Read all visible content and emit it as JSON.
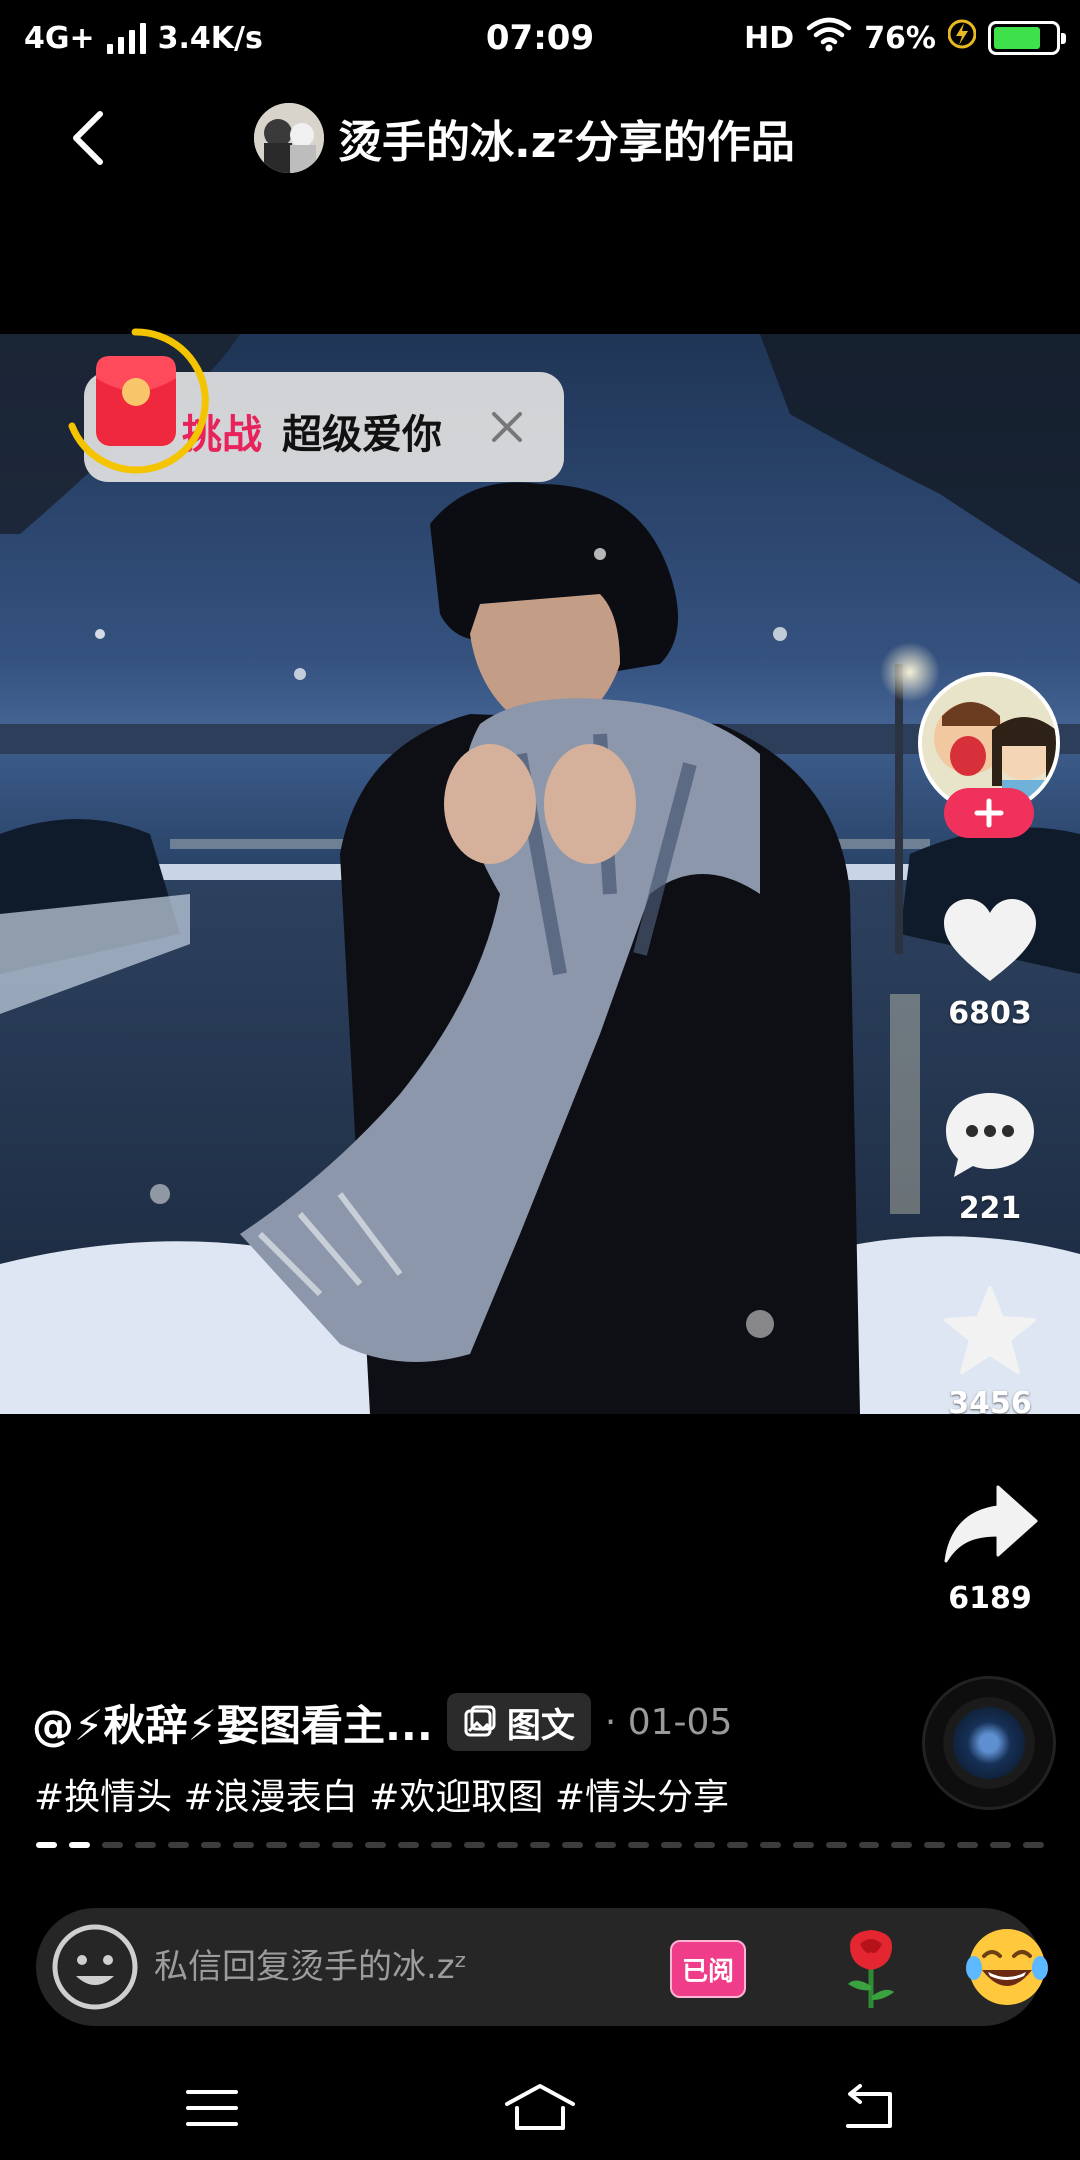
{
  "status_bar": {
    "network": "4G+",
    "speed": "3.4K/s",
    "time": "07:09",
    "hd": "HD",
    "battery": "76%"
  },
  "header": {
    "title": "烫手的冰.zᶻ分享的作品"
  },
  "challenge": {
    "label": "挑战",
    "text": "超级爱你"
  },
  "actions": {
    "likes": "6803",
    "comments": "221",
    "favorites": "3456",
    "shares": "6189"
  },
  "post": {
    "author": "@⚡秋辞⚡娶图看主...",
    "type_label": "图文",
    "date": "· 01-05",
    "hashtags": "#换情头 #浪漫表白 #欢迎取图 #情头分享",
    "pages_total": 31,
    "pages_seen": 2
  },
  "reply": {
    "placeholder": "私信回复烫手的冰.zᶻ",
    "read_label": "已阅"
  },
  "colors": {
    "accent_pink": "#f0315b",
    "battery_green": "#3fe14a",
    "challenge_red": "#e8225a"
  }
}
